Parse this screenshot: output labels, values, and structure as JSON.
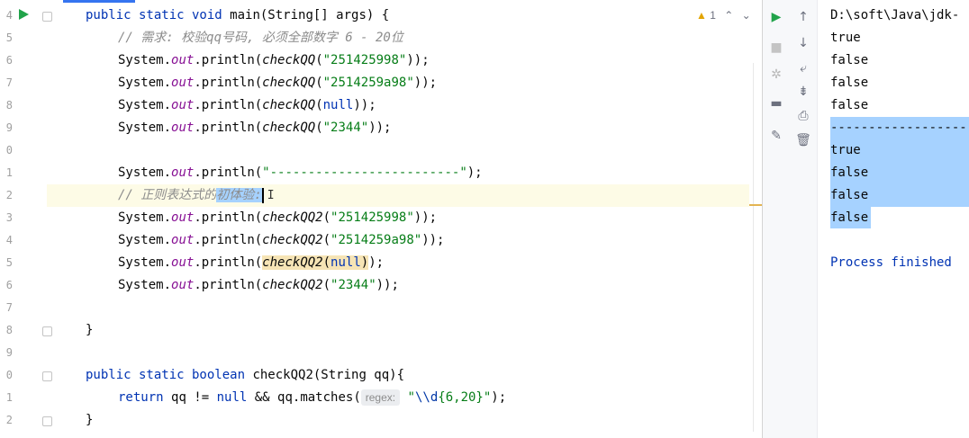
{
  "editor": {
    "line_numbers": [
      "4",
      "5",
      "6",
      "7",
      "8",
      "9",
      "0",
      "1",
      "2",
      "3",
      "4",
      "5",
      "6",
      "7",
      "8",
      "9",
      "0",
      "1",
      "2"
    ],
    "warning_count": "1",
    "lines": {
      "l0": {
        "kw": "public static void ",
        "rest": "main(String[] args) {"
      },
      "l1": {
        "comment": "// 需求: 校验qq号码, 必须全部数字 6 - 20位"
      },
      "l2": {
        "pre": "System.",
        "field": "out",
        "mid": ".println(",
        "method": "checkQQ",
        "open": "(",
        "str": "\"251425998\"",
        "end": "));"
      },
      "l3": {
        "pre": "System.",
        "field": "out",
        "mid": ".println(",
        "method": "checkQQ",
        "open": "(",
        "str": "\"2514259a98\"",
        "end": "));"
      },
      "l4": {
        "pre": "System.",
        "field": "out",
        "mid": ".println(",
        "method": "checkQQ",
        "open": "(",
        "kw": "null",
        "end": "));"
      },
      "l5": {
        "pre": "System.",
        "field": "out",
        "mid": ".println(",
        "method": "checkQQ",
        "open": "(",
        "str": "\"2344\"",
        "end": "));"
      },
      "l7": {
        "pre": "System.",
        "field": "out",
        "mid": ".println(",
        "str": "\"-------------------------\"",
        "end": ");"
      },
      "l8": {
        "comment": "// 正则表达式的",
        "selected": "初体验:"
      },
      "l9": {
        "pre": "System.",
        "field": "out",
        "mid": ".println(",
        "method": "checkQQ2",
        "open": "(",
        "str": "\"251425998\"",
        "end": "));"
      },
      "l10": {
        "pre": "System.",
        "field": "out",
        "mid": ".println(",
        "method": "checkQQ2",
        "open": "(",
        "str": "\"2514259a98\"",
        "end": "));"
      },
      "l11": {
        "pre": "System.",
        "field": "out",
        "mid": ".println(",
        "method": "checkQQ2",
        "open": "(",
        "kw": "null",
        "close": ")",
        "end": ");"
      },
      "l12": {
        "pre": "System.",
        "field": "out",
        "mid": ".println(",
        "method": "checkQQ2",
        "open": "(",
        "str": "\"2344\"",
        "end": "));"
      },
      "l14": {
        "brace": "}"
      },
      "l16": {
        "kw": "public static boolean ",
        "rest": "checkQQ2(String qq){"
      },
      "l17": {
        "kw": "return ",
        "a": "qq != ",
        "kw2": "null",
        "b": " && qq.matches(",
        "hint": "regex:",
        "q1": "\"",
        "esc": "\\\\d",
        "str": "{6,20}",
        "q2": "\"",
        "end": ");"
      },
      "l18": {
        "brace": "}"
      }
    }
  },
  "console": {
    "lines": [
      "D:\\soft\\Java\\jdk-",
      "true",
      "false",
      "false",
      "false",
      "-------------------------",
      "true",
      "false",
      "false",
      "false",
      "",
      "Process finished"
    ]
  },
  "icons": {
    "run": "run-icon",
    "stop": "stop-icon",
    "rerun": "rerun-icon",
    "layout": "layout-icon",
    "pin": "pin-icon",
    "up": "arrow-up-icon",
    "down": "arrow-down-icon",
    "wrap": "soft-wrap-icon",
    "scroll": "scroll-to-end-icon",
    "print": "print-icon",
    "trash": "trash-icon"
  },
  "colors": {
    "keyword": "#0033b3",
    "string": "#067d17",
    "field": "#871094",
    "comment": "#8c8c8c",
    "selection": "#a6d2ff",
    "run": "#21a34a"
  }
}
